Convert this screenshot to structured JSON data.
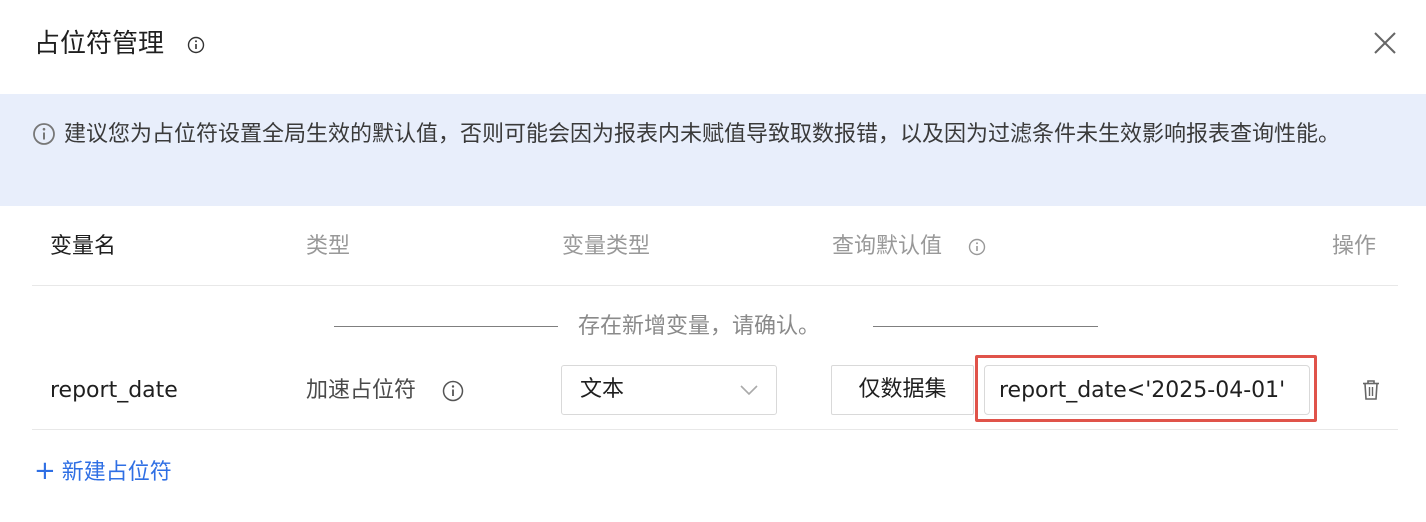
{
  "dialog": {
    "title": "占位符管理",
    "close_label": "close"
  },
  "notice": {
    "text": "建议您为占位符设置全局生效的默认值，否则可能会因为报表内未赋值导致取数报错，以及因为过滤条件未生效影响报表查询性能。"
  },
  "table": {
    "headers": {
      "name": "变量名",
      "type": "类型",
      "var_type": "变量类型",
      "default": "查询默认值",
      "operation": "操作"
    },
    "divider_text": "存在新增变量，请确认。",
    "rows": [
      {
        "name": "report_date",
        "type": "加速占位符",
        "var_type": "文本",
        "scope": "仅数据集",
        "default_value": "report_date<'2025-04-01'"
      }
    ]
  },
  "add_button": {
    "label": "新建占位符"
  },
  "colors": {
    "accent": "#2f6fe4",
    "notice_bg": "#e8eefb",
    "highlight": "#e0534a"
  }
}
